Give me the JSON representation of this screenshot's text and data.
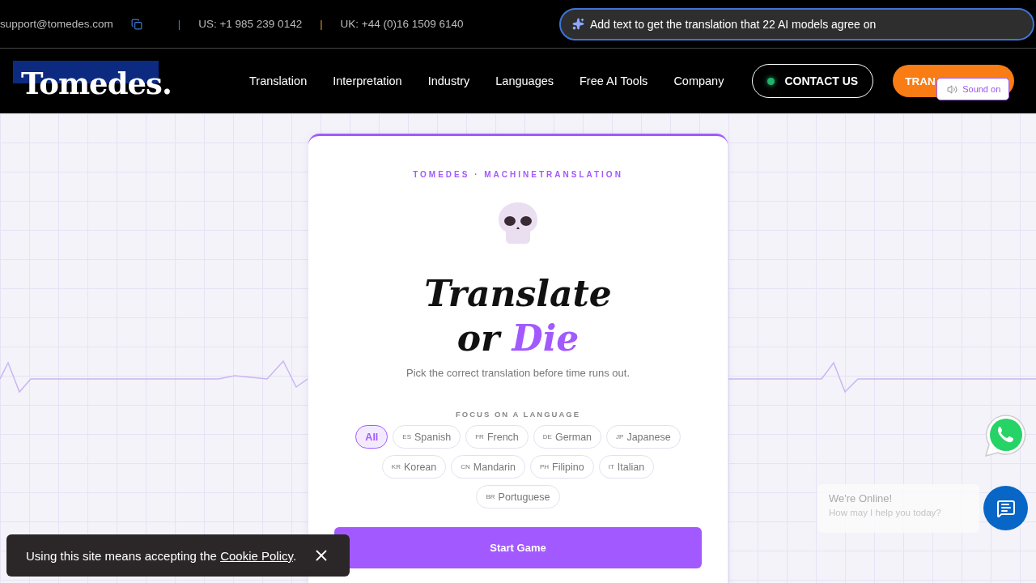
{
  "top_bar": {
    "email": "support@tomedes.com",
    "separator_1": "|",
    "us_phone": "US: +1 985 239 0142",
    "separator_2": "|",
    "uk_phone": "UK: +44 (0)16 1509 6140",
    "ai_prompt": {
      "placeholder": "Add text to get the translation that 22 AI models agree on"
    }
  },
  "nav": {
    "logo": "Tomedes.",
    "items": [
      "Translation",
      "Interpretation",
      "Industry",
      "Languages",
      "Free AI Tools",
      "Company"
    ],
    "contact_button": "CONTACT US",
    "translate_button": "TRAN",
    "sound_toggle": "Sound on"
  },
  "card": {
    "eyebrow": "TOMEDES · MACHINETRANSLATION",
    "title_line_1": "Translate",
    "title_line_2": "or",
    "title_accent": "Die",
    "subtitle": "Pick the correct translation before time runs out.",
    "focus_label": "FOCUS ON A LANGUAGE",
    "languages": [
      {
        "name": "All",
        "selected": true
      },
      {
        "code": "ES",
        "name": "Spanish",
        "selected": false
      },
      {
        "code": "FR",
        "name": "French",
        "selected": false
      },
      {
        "code": "DE",
        "name": "German",
        "selected": false
      },
      {
        "code": "JP",
        "name": "Japanese",
        "selected": false
      },
      {
        "code": "KR",
        "name": "Korean",
        "selected": false
      },
      {
        "code": "CN",
        "name": "Mandarin",
        "selected": false
      },
      {
        "code": "PH",
        "name": "Filipino",
        "selected": false
      },
      {
        "code": "IT",
        "name": "Italian",
        "selected": false
      },
      {
        "code": "BR",
        "name": "Portuguese",
        "selected": false
      }
    ],
    "start_button": "Start Game"
  },
  "cookie_banner": {
    "text": "Using this site means accepting the",
    "link": "Cookie Policy",
    "end": "."
  },
  "chat": {
    "title": "We're Online!",
    "subtitle": "How may I help you today?"
  }
}
